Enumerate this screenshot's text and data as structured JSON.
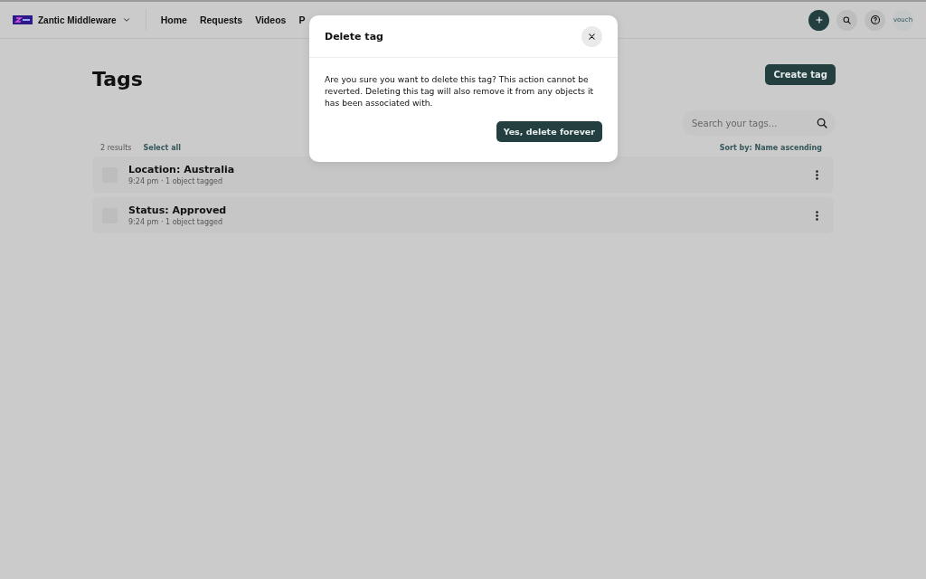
{
  "header": {
    "workspace": "Zantic Middleware",
    "nav": [
      "Home",
      "Requests",
      "Videos",
      "P"
    ],
    "avatar": "vouch"
  },
  "page": {
    "title": "Tags",
    "create_button": "Create tag",
    "search": {
      "placeholder": "Search your tags..."
    },
    "results": "2 results",
    "select_all": "Select all",
    "sort": "Sort by: Name ascending"
  },
  "tags": [
    {
      "name": "Location: Australia",
      "meta": "9:24 pm · 1 object tagged",
      "checked": false
    },
    {
      "name": "Status: Approved",
      "meta": "9:24 pm · 1 object tagged",
      "checked": false
    }
  ],
  "dialog": {
    "title": "Delete tag",
    "message": "Are you sure you want to delete this tag? This action cannot be reverted. Deleting this tag will also remove it from any objects it has been associated with.",
    "confirm": "Yes, delete forever"
  }
}
